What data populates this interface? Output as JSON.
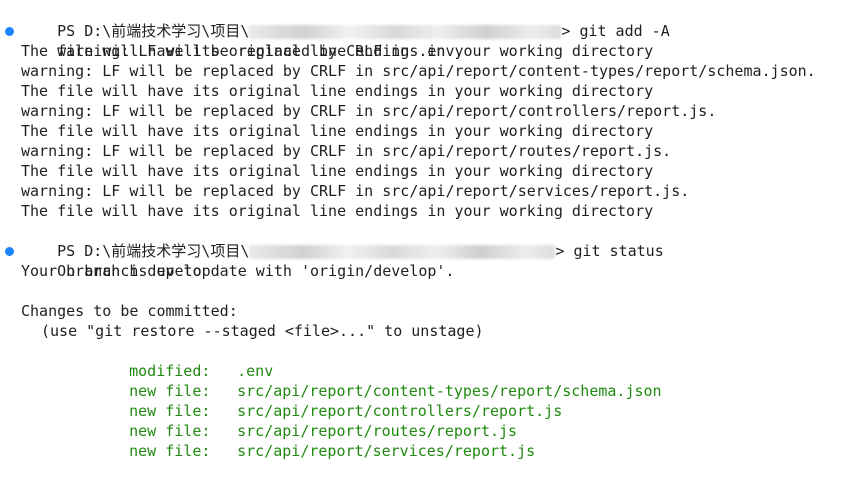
{
  "terminal": {
    "accent_dot_color": "#1a85ff",
    "staged_color": "#1f8a0f",
    "prompt1": {
      "prefix": "PS D:\\前端技术学习\\项目\\",
      "suffix": "> ",
      "command": "git add -A"
    },
    "add_output": [
      "warning: LF will be replaced by CRLF in .env.",
      "The file will have its original line endings in your working directory",
      "warning: LF will be replaced by CRLF in src/api/report/content-types/report/schema.json.",
      "The file will have its original line endings in your working directory",
      "warning: LF will be replaced by CRLF in src/api/report/controllers/report.js.",
      "The file will have its original line endings in your working directory",
      "warning: LF will be replaced by CRLF in src/api/report/routes/report.js.",
      "The file will have its original line endings in your working directory",
      "warning: LF will be replaced by CRLF in src/api/report/services/report.js.",
      "The file will have its original line endings in your working directory"
    ],
    "prompt2": {
      "prefix": "PS D:\\前端技术学习\\项目\\",
      "suffix": "> ",
      "command": "git status"
    },
    "status": {
      "branch_line": "On branch develop",
      "uptodate_line": "Your branch is up to date with 'origin/develop'.",
      "changes_header": "Changes to be committed:",
      "hint": "(use \"git restore --staged <file>...\" to unstage)",
      "files": [
        {
          "kind": "modified:",
          "path": ".env"
        },
        {
          "kind": "new file:",
          "path": "src/api/report/content-types/report/schema.json"
        },
        {
          "kind": "new file:",
          "path": "src/api/report/controllers/report.js"
        },
        {
          "kind": "new file:",
          "path": "src/api/report/routes/report.js"
        },
        {
          "kind": "new file:",
          "path": "src/api/report/services/report.js"
        }
      ]
    }
  }
}
